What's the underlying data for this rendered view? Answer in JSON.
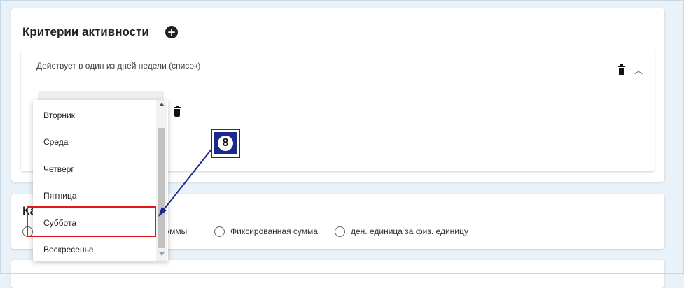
{
  "criteria": {
    "title": "Критерии активности",
    "add_icon": "plus-circle-icon",
    "panel_title": "Действует в один из дней недели (список)",
    "delete_icon": "trash-icon",
    "collapse_icon": "chevron-up-icon"
  },
  "dropdown": {
    "options": [
      "Вторник",
      "Среда",
      "Четверг",
      "Пятница",
      "Суббота",
      "Воскресенье"
    ],
    "highlighted": "Суббота"
  },
  "second_card": {
    "title_visible": "Ка",
    "radio_1_label": "от суммы",
    "radio_2_label": "Фиксированная сумма",
    "radio_3_label": "ден. единица за физ. единицу"
  },
  "annotation": {
    "step_number": "8",
    "colors": {
      "box": "#e0181e",
      "arrow": "#1a2a8a"
    }
  }
}
